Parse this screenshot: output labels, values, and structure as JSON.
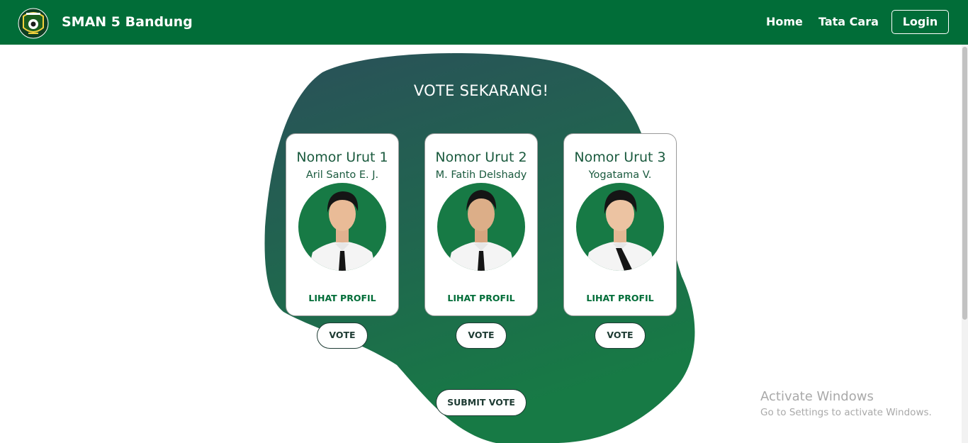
{
  "navbar": {
    "brand": "SMAN 5 Bandung",
    "links": [
      "Home",
      "Tata Cara"
    ],
    "login_label": "Login",
    "background": "#016d38"
  },
  "main": {
    "title": "VOTE SEKARANG!",
    "blob_gradient": [
      "#2a5059",
      "#177a45"
    ],
    "candidates": [
      {
        "number_label": "Nomor Urut 1",
        "name": "Aril Santo E. J.",
        "profile_label": "LIHAT PROFIL",
        "vote_label": "VOTE"
      },
      {
        "number_label": "Nomor Urut 2",
        "name": "M. Fatih Delshady",
        "profile_label": "LIHAT PROFIL",
        "vote_label": "VOTE"
      },
      {
        "number_label": "Nomor Urut 3",
        "name": "Yogatama V.",
        "profile_label": "LIHAT PROFIL",
        "vote_label": "VOTE"
      }
    ],
    "submit_label": "SUBMIT VOTE"
  },
  "watermark": {
    "title": "Activate Windows",
    "subtitle": "Go to Settings to activate Windows."
  }
}
